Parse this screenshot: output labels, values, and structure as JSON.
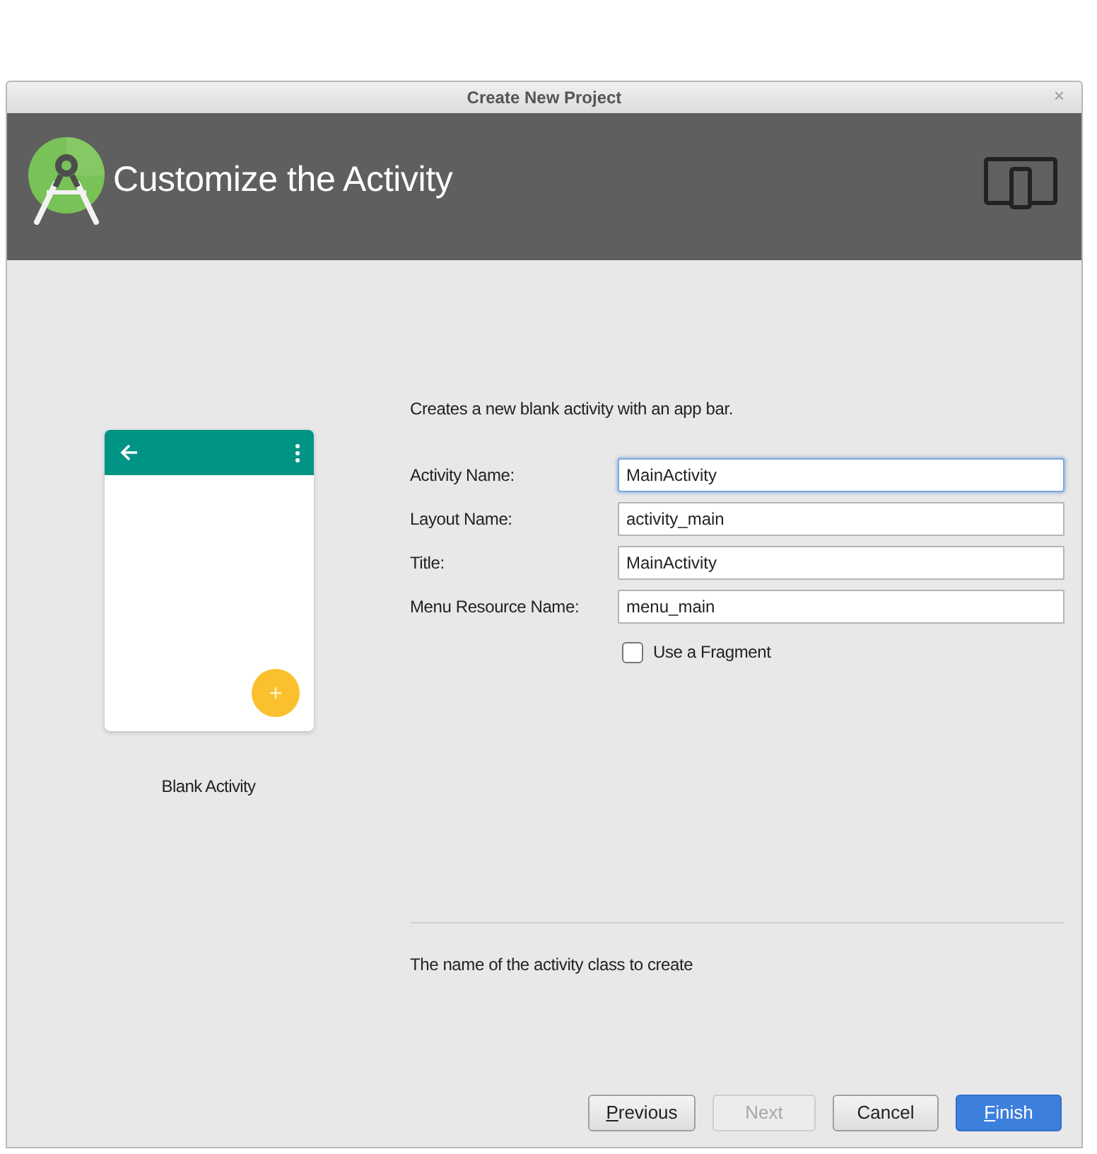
{
  "window": {
    "title": "Create New Project",
    "close": "×"
  },
  "header": {
    "title": "Customize the Activity"
  },
  "template": {
    "label": "Blank Activity"
  },
  "form": {
    "description": "Creates a new blank activity with an app bar.",
    "fields": [
      {
        "label": "Activity Name:",
        "value": "MainActivity",
        "focused": true
      },
      {
        "label": "Layout Name:",
        "value": "activity_main",
        "focused": false
      },
      {
        "label": "Title:",
        "value": "MainActivity",
        "focused": false
      },
      {
        "label": "Menu Resource Name:",
        "value": "menu_main",
        "focused": false
      }
    ],
    "checkbox": {
      "label": "Use a Fragment",
      "checked": false
    },
    "help_text": "The name of the activity class to create"
  },
  "buttons": [
    {
      "label": "Previous",
      "kind": "default",
      "disabled": false,
      "mnemonic": true
    },
    {
      "label": "Next",
      "kind": "default",
      "disabled": true,
      "mnemonic": false
    },
    {
      "label": "Cancel",
      "kind": "default",
      "disabled": false,
      "mnemonic": false
    },
    {
      "label": "Finish",
      "kind": "primary",
      "disabled": false,
      "mnemonic": true
    }
  ]
}
